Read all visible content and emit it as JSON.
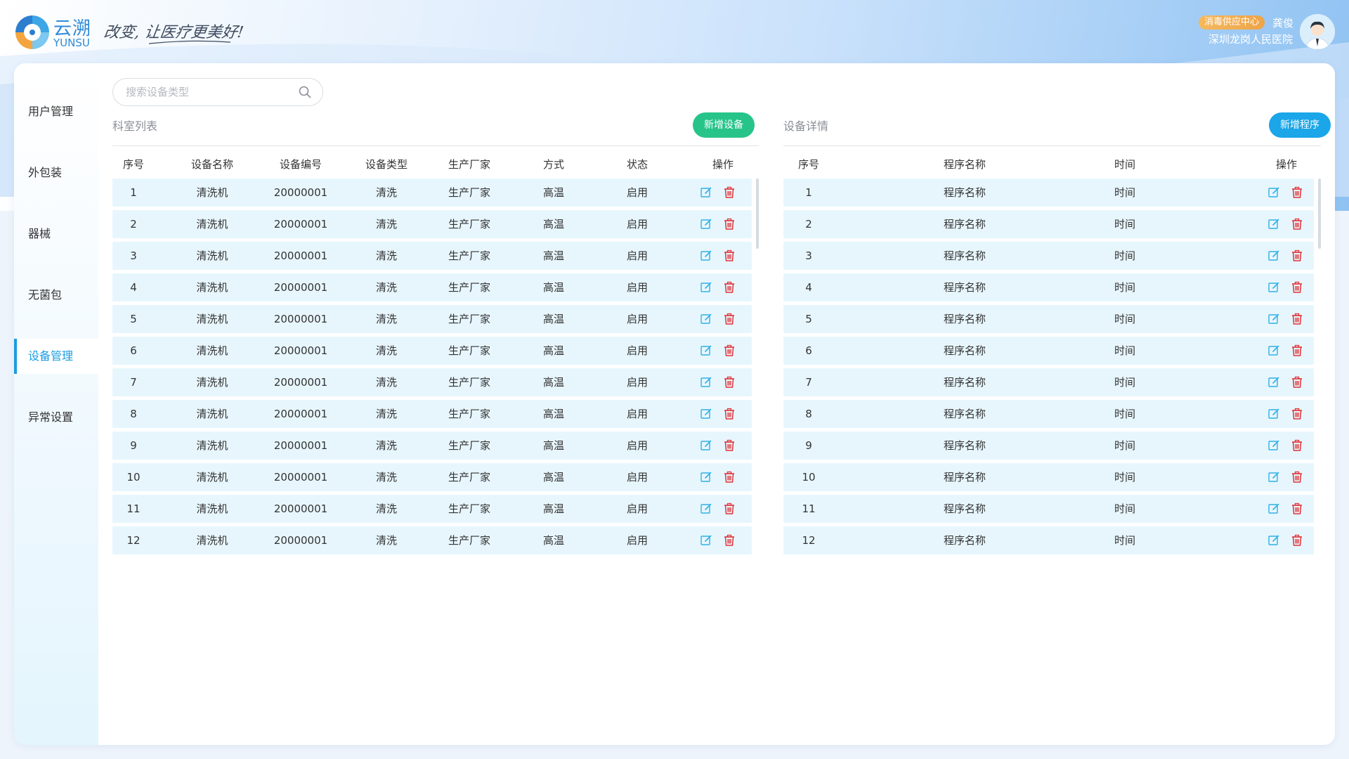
{
  "header": {
    "brand_cn": "云溯",
    "brand_en": "YUNSU",
    "slogan": "改变, 让医疗更美好!",
    "user_badge": "消毒供应中心",
    "user_name": "龚俊",
    "hospital": "深圳龙岗人民医院"
  },
  "sidebar": {
    "items": [
      {
        "label": "用户管理",
        "active": false
      },
      {
        "label": "外包装",
        "active": false
      },
      {
        "label": "器械",
        "active": false
      },
      {
        "label": "无菌包",
        "active": false
      },
      {
        "label": "设备管理",
        "active": true
      },
      {
        "label": "异常设置",
        "active": false
      }
    ]
  },
  "search": {
    "placeholder": "搜索设备类型",
    "value": ""
  },
  "left_panel": {
    "title": "科室列表",
    "add_button": "新增设备",
    "columns": [
      "序号",
      "设备名称",
      "设备编号",
      "设备类型",
      "生产厂家",
      "方式",
      "状态",
      "操作"
    ],
    "rows": [
      {
        "no": "1",
        "name": "清洗机",
        "code": "20000001",
        "type": "清洗",
        "maker": "生产厂家",
        "mode": "高温",
        "status": "启用"
      },
      {
        "no": "2",
        "name": "清洗机",
        "code": "20000001",
        "type": "清洗",
        "maker": "生产厂家",
        "mode": "高温",
        "status": "启用"
      },
      {
        "no": "3",
        "name": "清洗机",
        "code": "20000001",
        "type": "清洗",
        "maker": "生产厂家",
        "mode": "高温",
        "status": "启用"
      },
      {
        "no": "4",
        "name": "清洗机",
        "code": "20000001",
        "type": "清洗",
        "maker": "生产厂家",
        "mode": "高温",
        "status": "启用"
      },
      {
        "no": "5",
        "name": "清洗机",
        "code": "20000001",
        "type": "清洗",
        "maker": "生产厂家",
        "mode": "高温",
        "status": "启用"
      },
      {
        "no": "6",
        "name": "清洗机",
        "code": "20000001",
        "type": "清洗",
        "maker": "生产厂家",
        "mode": "高温",
        "status": "启用"
      },
      {
        "no": "7",
        "name": "清洗机",
        "code": "20000001",
        "type": "清洗",
        "maker": "生产厂家",
        "mode": "高温",
        "status": "启用"
      },
      {
        "no": "8",
        "name": "清洗机",
        "code": "20000001",
        "type": "清洗",
        "maker": "生产厂家",
        "mode": "高温",
        "status": "启用"
      },
      {
        "no": "9",
        "name": "清洗机",
        "code": "20000001",
        "type": "清洗",
        "maker": "生产厂家",
        "mode": "高温",
        "status": "启用"
      },
      {
        "no": "10",
        "name": "清洗机",
        "code": "20000001",
        "type": "清洗",
        "maker": "生产厂家",
        "mode": "高温",
        "status": "启用"
      },
      {
        "no": "11",
        "name": "清洗机",
        "code": "20000001",
        "type": "清洗",
        "maker": "生产厂家",
        "mode": "高温",
        "status": "启用"
      },
      {
        "no": "12",
        "name": "清洗机",
        "code": "20000001",
        "type": "清洗",
        "maker": "生产厂家",
        "mode": "高温",
        "status": "启用"
      }
    ]
  },
  "right_panel": {
    "title": "设备详情",
    "add_button": "新增程序",
    "columns": [
      "序号",
      "程序名称",
      "时间",
      "操作"
    ],
    "rows": [
      {
        "no": "1",
        "program": "程序名称",
        "time": "时间"
      },
      {
        "no": "2",
        "program": "程序名称",
        "time": "时间"
      },
      {
        "no": "3",
        "program": "程序名称",
        "time": "时间"
      },
      {
        "no": "4",
        "program": "程序名称",
        "time": "时间"
      },
      {
        "no": "5",
        "program": "程序名称",
        "time": "时间"
      },
      {
        "no": "6",
        "program": "程序名称",
        "time": "时间"
      },
      {
        "no": "7",
        "program": "程序名称",
        "time": "时间"
      },
      {
        "no": "8",
        "program": "程序名称",
        "time": "时间"
      },
      {
        "no": "9",
        "program": "程序名称",
        "time": "时间"
      },
      {
        "no": "10",
        "program": "程序名称",
        "time": "时间"
      },
      {
        "no": "11",
        "program": "程序名称",
        "time": "时间"
      },
      {
        "no": "12",
        "program": "程序名称",
        "time": "时间"
      }
    ]
  },
  "icons": {
    "edit": "edit-icon",
    "delete": "trash-icon",
    "search": "search-icon"
  },
  "colors": {
    "accent": "#1a9ce0",
    "add_device": "#27c48a",
    "add_program": "#1aa6e8",
    "row_bg": "#e7f6fd",
    "delete": "#e0343a",
    "edit": "#2fb0e6",
    "badge": "#f0a94e"
  }
}
